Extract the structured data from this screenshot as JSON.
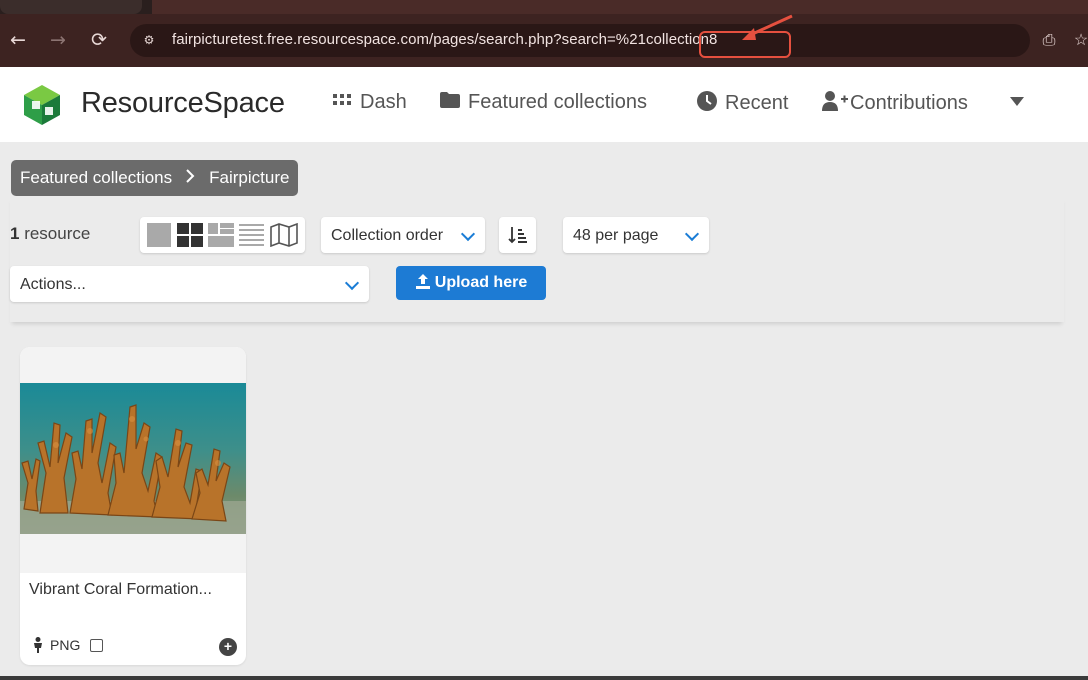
{
  "browser": {
    "url": "fairpicturetest.free.resourcespace.com/pages/search.php?search=%21collection8",
    "url_prefix": "fairpicturetest.free.resourcespace.com/pages/search.php?search=%21",
    "url_highlight": "collection8",
    "highlight_color": "#e5503f",
    "nav": {
      "back": "←",
      "forward": "→",
      "reload": "⟳"
    }
  },
  "header": {
    "logo_text_a": "Resource",
    "logo_text_b": "Space",
    "nav": [
      {
        "label": "Dash",
        "icon": "grid-icon"
      },
      {
        "label": "Featured collections",
        "icon": "folder-icon"
      },
      {
        "label": "Recent",
        "icon": "clock-icon"
      },
      {
        "label": "Contributions",
        "icon": "user-plus-icon"
      }
    ]
  },
  "breadcrumb": {
    "items": [
      "Featured collections",
      "Fairpicture"
    ],
    "separator": ">"
  },
  "toolbar": {
    "count_number": "1",
    "count_label": " resource",
    "sort_select": "Collection order",
    "per_page_select": "48 per page",
    "actions_select": "Actions...",
    "upload_label": "Upload here",
    "accent_color": "#1d7bd4"
  },
  "resources": [
    {
      "title": "Vibrant Coral Formation...",
      "file_type": "PNG"
    }
  ]
}
